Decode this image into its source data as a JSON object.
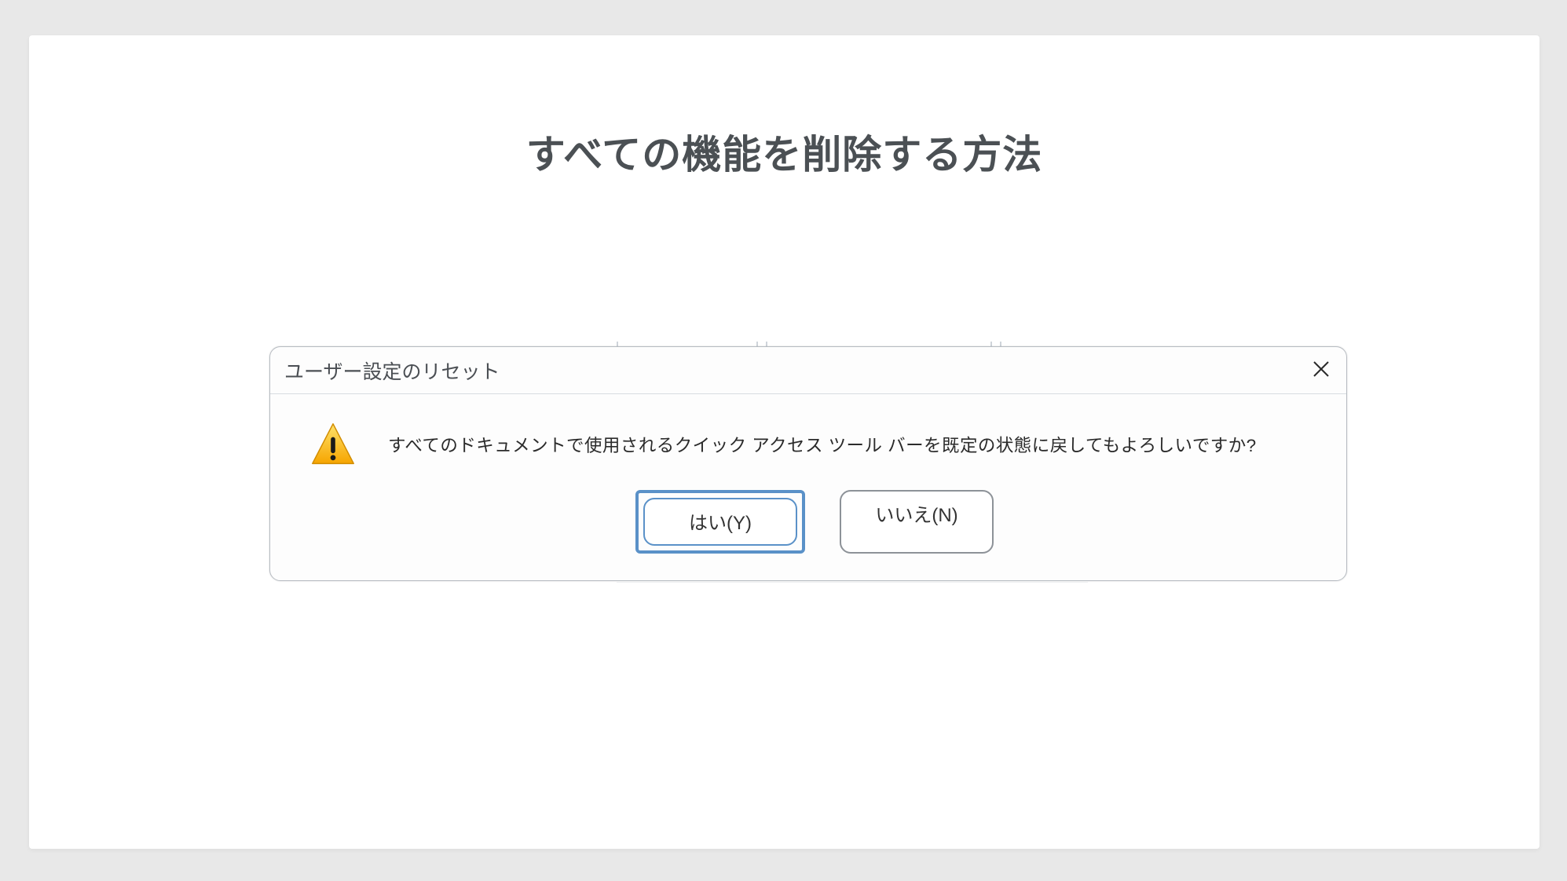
{
  "page": {
    "title": "すべての機能を削除する方法"
  },
  "dialog": {
    "title": "ユーザー設定のリセット",
    "message": "すべてのドキュメントで使用されるクイック アクセス ツール バーを既定の状態に戻してもよろしいですか?",
    "buttons": {
      "yes": "はい(Y)",
      "no": "いいえ(N)"
    }
  }
}
